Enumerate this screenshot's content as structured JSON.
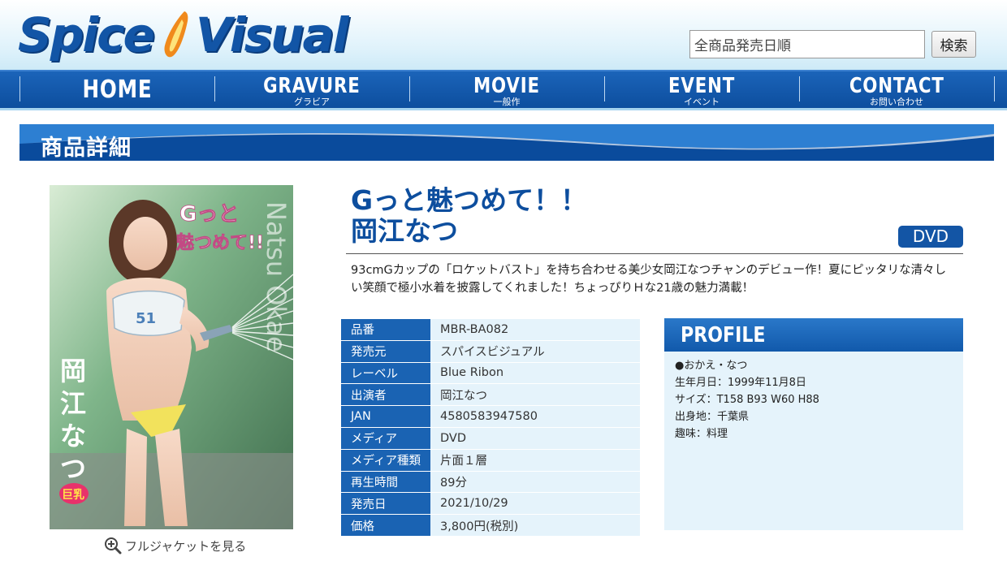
{
  "header": {
    "logo_text_1": "Spice",
    "logo_text_2": "Visual",
    "search_value": "全商品発売日順",
    "search_button": "検索"
  },
  "nav": [
    {
      "label": "HOME",
      "sub": ""
    },
    {
      "label": "GRAVURE",
      "sub": "グラビア"
    },
    {
      "label": "MOVIE",
      "sub": "一般作"
    },
    {
      "label": "EVENT",
      "sub": "イベント"
    },
    {
      "label": "CONTACT",
      "sub": "お問い合わせ"
    }
  ],
  "section_title": "商品詳細",
  "jacket": {
    "cover_title": "Gっと魅つめて!!",
    "cover_name": "岡江なつ",
    "cover_romaji": "Natsu Okae",
    "cover_badge": "巨乳",
    "cover_tagline": "ちょっぴりHな21歳の魅力満載!",
    "full_jacket_link": "フルジャケットを見る"
  },
  "product": {
    "title_line1": "Gっと魅つめて！！",
    "title_line2": "岡江なつ",
    "media_badge": "DVD",
    "description": "93cmGカップの「ロケットバスト」を持ち合わせる美少女岡江なつチャンのデビュー作！夏にピッタリな清々しい笑顔で極小水着を披露してくれました！ちょっぴりＨな21歳の魅力満載！"
  },
  "spec": [
    {
      "key": "品番",
      "value": "MBR-BA082"
    },
    {
      "key": "発売元",
      "value": "スパイスビジュアル"
    },
    {
      "key": "レーベル",
      "value": "Blue Ribon"
    },
    {
      "key": "出演者",
      "value": "岡江なつ"
    },
    {
      "key": "JAN",
      "value": "4580583947580"
    },
    {
      "key": "メディア",
      "value": "DVD"
    },
    {
      "key": "メディア種類",
      "value": "片面１層"
    },
    {
      "key": "再生時間",
      "value": "89分"
    },
    {
      "key": "発売日",
      "value": "2021/10/29"
    },
    {
      "key": "価格",
      "value": "3,800円(税別)"
    }
  ],
  "profile": {
    "heading": "PROFILE",
    "lines": [
      "●おかえ・なつ",
      "生年月日：1999年11月8日",
      "サイズ：T158 B93 W60 H88",
      "出身地：千葉県",
      "趣味：料理"
    ]
  },
  "colors": {
    "brand_blue": "#1255a6",
    "nav_blue": "#1b64b9",
    "cell_bg": "#e5f3fb",
    "flame_orange": "#f08a1c"
  }
}
